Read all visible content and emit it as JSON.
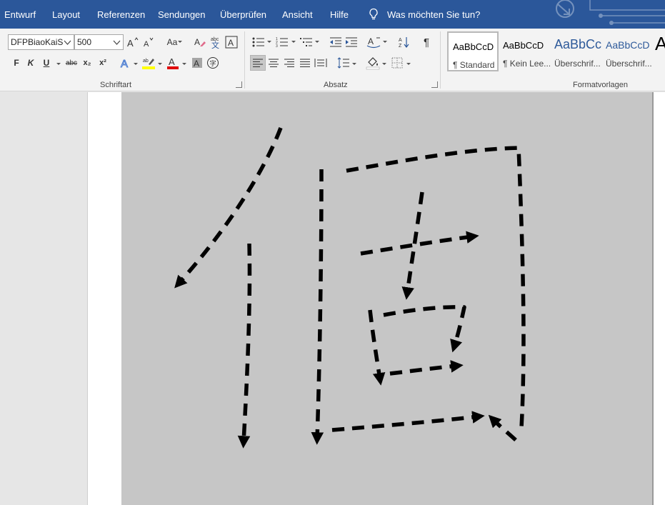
{
  "menu": {
    "tabs": [
      "Entwurf",
      "Layout",
      "Referenzen",
      "Sendungen",
      "Überprüfen",
      "Ansicht",
      "Hilfe"
    ],
    "tell_me": "Was möchten Sie tun?"
  },
  "font": {
    "family": "DFPBiaoKaiS",
    "size": "500",
    "bold": "F",
    "italic": "K",
    "underline": "U",
    "strike": "abc",
    "sub": "x₂",
    "sup": "x²",
    "case": "Aa",
    "group_label": "Schriftart",
    "highlight_color": "#ffff00",
    "font_color": "#e00000"
  },
  "paragraph": {
    "group_label": "Absatz"
  },
  "styles": {
    "group_label": "Formatvorlagen",
    "items": [
      {
        "preview": "AaBbCcD",
        "name": "¶ Standard"
      },
      {
        "preview": "AaBbCcD",
        "name": "¶ Kein Lee..."
      },
      {
        "preview": "AaBbCc",
        "name": "Überschrif..."
      },
      {
        "preview": "AaBbCcD",
        "name": "Überschrif..."
      },
      {
        "preview": "A",
        "name": ""
      }
    ]
  },
  "colors": {
    "accent": "#2b579a",
    "canvas": "#c6c6c6"
  }
}
